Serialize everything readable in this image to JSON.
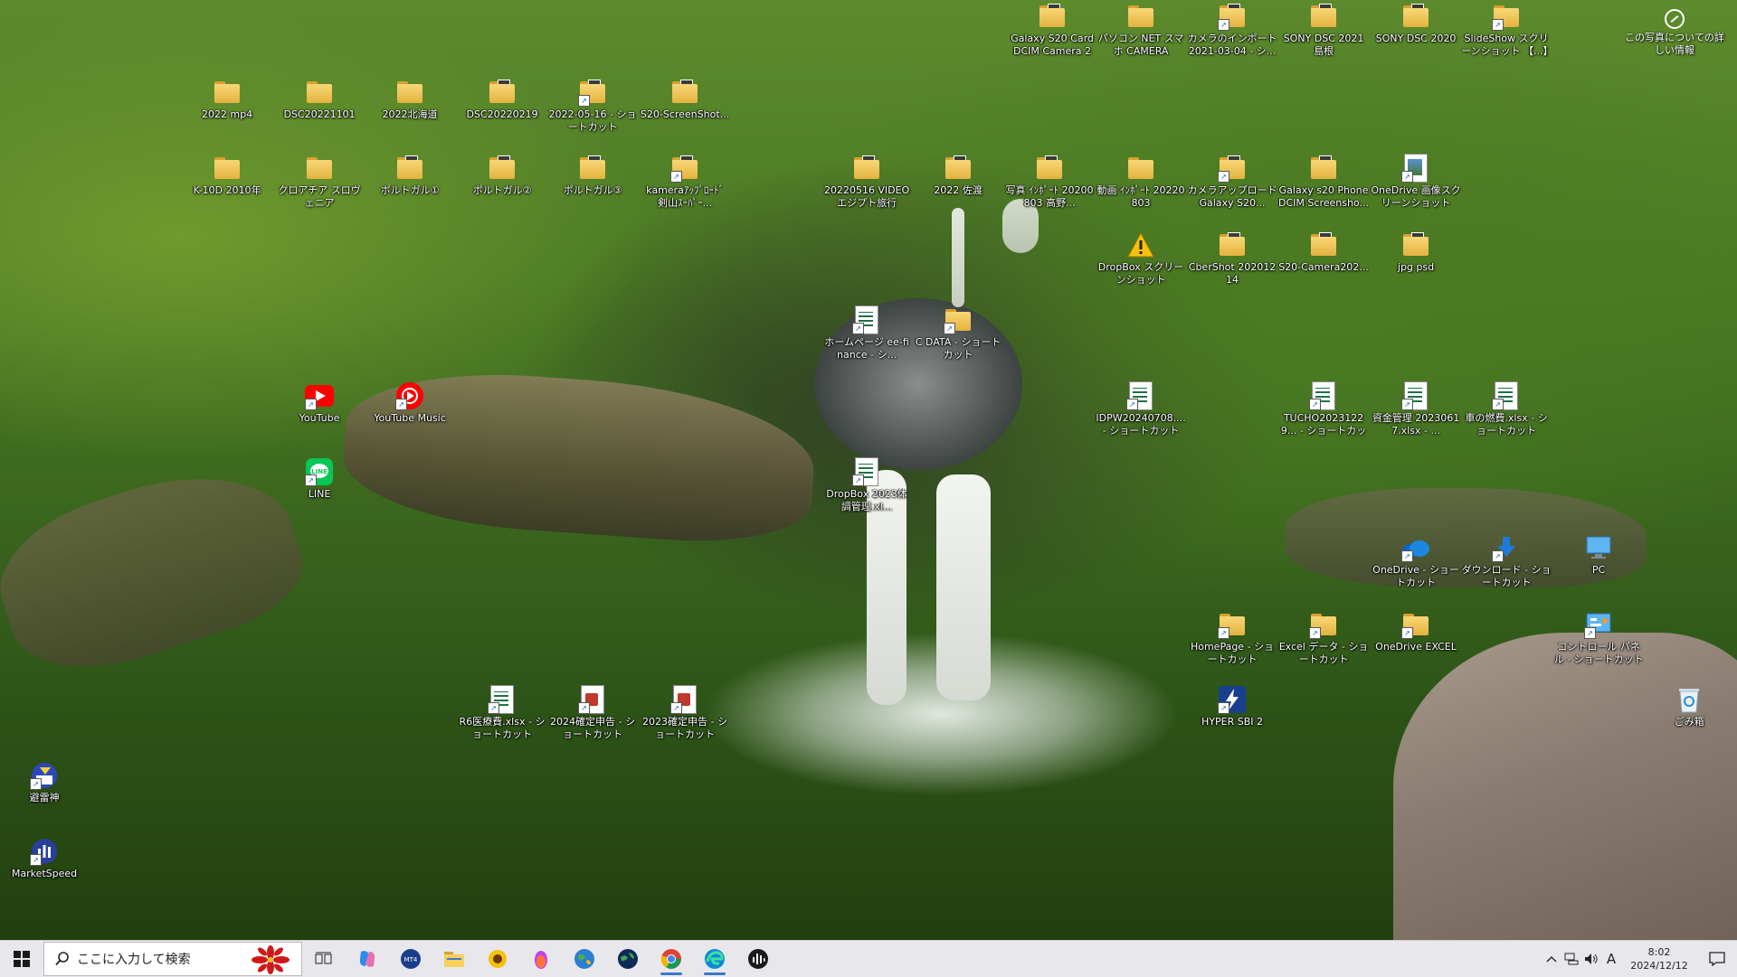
{
  "wallpaper": {
    "description_name": "waterfall-canyon"
  },
  "photo_info": {
    "label": "この写真についての詳しい情報"
  },
  "desktop_icons": [
    {
      "id": "g20card",
      "label": "Galaxy S20 Card DCIM Camera 20...",
      "type": "folder",
      "thumb": true,
      "shortcut": false
    },
    {
      "id": "pcnet",
      "label": "パソコン NET スマホ CAMERA",
      "type": "folder",
      "thumb": false,
      "shortcut": false
    },
    {
      "id": "camimport",
      "label": "カメラのインポート 2021-03-04 - シ...",
      "type": "folder",
      "thumb": true,
      "shortcut": true
    },
    {
      "id": "sony2021",
      "label": "SONY DSC 2021 島根",
      "type": "folder",
      "thumb": true,
      "shortcut": false
    },
    {
      "id": "sony2020",
      "label": "SONY DSC 2020",
      "type": "folder",
      "thumb": true,
      "shortcut": false
    },
    {
      "id": "slideshow",
      "label": "SlideShow スクリーンショット 【...】",
      "type": "folder",
      "thumb": false,
      "shortcut": true
    },
    {
      "id": "mp4",
      "label": "2022 mp4",
      "type": "folder",
      "thumb": false,
      "shortcut": false
    },
    {
      "id": "dsc20221101",
      "label": "DSC20221101",
      "type": "folder",
      "thumb": false,
      "shortcut": false
    },
    {
      "id": "hokkaido",
      "label": "2022北海道",
      "type": "folder",
      "thumb": false,
      "shortcut": false
    },
    {
      "id": "dsc20220219",
      "label": "DSC20220219",
      "type": "folder",
      "thumb": true,
      "shortcut": false
    },
    {
      "id": "s20240516",
      "label": "2022-05-16 - ショートカット",
      "type": "folder",
      "thumb": true,
      "shortcut": true
    },
    {
      "id": "s20ss",
      "label": "S20-ScreenShot...",
      "type": "folder",
      "thumb": true,
      "shortcut": false
    },
    {
      "id": "k10d",
      "label": "K-10D 2010年",
      "type": "folder",
      "thumb": false,
      "shortcut": false
    },
    {
      "id": "croatia",
      "label": "クロアチア スロヴェニア",
      "type": "folder",
      "thumb": false,
      "shortcut": false
    },
    {
      "id": "port1",
      "label": "ポルトガル①",
      "type": "folder",
      "thumb": true,
      "shortcut": false
    },
    {
      "id": "port2",
      "label": "ポルトガル②",
      "type": "folder",
      "thumb": true,
      "shortcut": false
    },
    {
      "id": "port3",
      "label": "ポルトガル③",
      "type": "folder",
      "thumb": true,
      "shortcut": false
    },
    {
      "id": "kamera",
      "label": "kameraｱｯﾌﾟﾛｰﾄﾞ 剣山ｽｰﾊﾟｰ...",
      "type": "folder",
      "thumb": true,
      "shortcut": true
    },
    {
      "id": "video0516",
      "label": "20220516 VIDEO エジプト旅行",
      "type": "folder",
      "thumb": true,
      "shortcut": false
    },
    {
      "id": "sado",
      "label": "2022 佐渡",
      "type": "folder",
      "thumb": true,
      "shortcut": false
    },
    {
      "id": "photo0803",
      "label": "写真 ｲﾝﾎﾟｰﾄ 20200803 高野...",
      "type": "folder",
      "thumb": true,
      "shortcut": false
    },
    {
      "id": "movie0803",
      "label": "動画 ｲﾝﾎﾟｰﾄ 20220803",
      "type": "folder",
      "thumb": false,
      "shortcut": false
    },
    {
      "id": "camupload",
      "label": "カメラアップロード Galaxy S20...",
      "type": "folder",
      "thumb": true,
      "shortcut": true
    },
    {
      "id": "gs20dcim",
      "label": "Galaxy s20 Phone DCIM Screensho...",
      "type": "folder",
      "thumb": true,
      "shortcut": false
    },
    {
      "id": "odimg",
      "label": "OneDrive 画像スクリーンショット",
      "type": "file-img",
      "thumb": false,
      "shortcut": true
    },
    {
      "id": "dbss",
      "label": "DropBox スクリーンショット",
      "type": "warning",
      "thumb": false,
      "shortcut": false
    },
    {
      "id": "cbershot",
      "label": "CberShot 20201214",
      "type": "folder",
      "thumb": true,
      "shortcut": false
    },
    {
      "id": "s20cam",
      "label": "S20-Camera202...",
      "type": "folder",
      "thumb": true,
      "shortcut": false
    },
    {
      "id": "jpgpsd",
      "label": "jpg psd",
      "type": "folder",
      "thumb": true,
      "shortcut": false
    },
    {
      "id": "homefin",
      "label": "ホームページ ee-finance - シ...",
      "type": "file-xls",
      "thumb": false,
      "shortcut": true
    },
    {
      "id": "cdata",
      "label": "C DATA - ショートカット",
      "type": "folder",
      "thumb": false,
      "shortcut": true
    },
    {
      "id": "youtube",
      "label": "YouTube",
      "type": "youtube",
      "thumb": false,
      "shortcut": true
    },
    {
      "id": "ytmusic",
      "label": "YouTube Music",
      "type": "ytmusic",
      "thumb": false,
      "shortcut": true
    },
    {
      "id": "line",
      "label": "LINE",
      "type": "line",
      "thumb": false,
      "shortcut": true
    },
    {
      "id": "idpw",
      "label": "IDPW20240708.... - ショートカット",
      "type": "file-xls",
      "thumb": false,
      "shortcut": true
    },
    {
      "id": "tucho",
      "label": "TUCHO20231229... - ショートカット",
      "type": "file-xls",
      "thumb": false,
      "shortcut": true
    },
    {
      "id": "shikin",
      "label": "資金管理 20230617.xlsx - ...",
      "type": "file-xls",
      "thumb": false,
      "shortcut": true
    },
    {
      "id": "nenpi",
      "label": "車の燃費.xlsx - ショートカット",
      "type": "file-xls",
      "thumb": false,
      "shortcut": true
    },
    {
      "id": "dbtaicho",
      "label": "DropBox 2023体調管理.xl...",
      "type": "file-xls",
      "thumb": false,
      "shortcut": true
    },
    {
      "id": "odshort",
      "label": "OneDrive - ショートカット",
      "type": "cloud",
      "thumb": false,
      "shortcut": true
    },
    {
      "id": "download",
      "label": "ダウンロード - ショートカット",
      "type": "download",
      "thumb": false,
      "shortcut": true
    },
    {
      "id": "pc",
      "label": "PC",
      "type": "pc",
      "thumb": false,
      "shortcut": false
    },
    {
      "id": "homepage",
      "label": "HomePage - ショートカット",
      "type": "folder",
      "thumb": false,
      "shortcut": true
    },
    {
      "id": "exceldata",
      "label": "Excel データ - ショートカット",
      "type": "folder",
      "thumb": false,
      "shortcut": true
    },
    {
      "id": "odexcel",
      "label": "OneDrive EXCEL",
      "type": "folder",
      "thumb": false,
      "shortcut": true
    },
    {
      "id": "control",
      "label": "コントロール パネル - ショートカット",
      "type": "control",
      "thumb": false,
      "shortcut": true
    },
    {
      "id": "hypersbi",
      "label": "HYPER SBI 2",
      "type": "hyper",
      "thumb": false,
      "shortcut": true
    },
    {
      "id": "recycle",
      "label": "ごみ箱",
      "type": "recycle",
      "thumb": false,
      "shortcut": false
    },
    {
      "id": "r6iryo",
      "label": "R6医療費.xlsx - ショートカット",
      "type": "file-xls",
      "thumb": false,
      "shortcut": true
    },
    {
      "id": "kakutei2024",
      "label": "2024確定申告 - ショートカット",
      "type": "file-pdf",
      "thumb": false,
      "shortcut": true
    },
    {
      "id": "kakutei2023",
      "label": "2023確定申告 - ショートカット",
      "type": "file-pdf",
      "thumb": false,
      "shortcut": true
    },
    {
      "id": "hirai",
      "label": "避雷神",
      "type": "hirai",
      "thumb": false,
      "shortcut": true
    },
    {
      "id": "marketspeed",
      "label": "MarketSpeed",
      "type": "marketspeed",
      "thumb": false,
      "shortcut": true
    }
  ],
  "taskbar": {
    "search_placeholder": "ここに入力して検索",
    "apps": [
      {
        "id": "taskview",
        "name": "task-view-icon"
      },
      {
        "id": "copilot",
        "name": "copilot-icon"
      },
      {
        "id": "mt4",
        "name": "mt4-icon"
      },
      {
        "id": "explorer",
        "name": "file-explorer-icon"
      },
      {
        "id": "sunflower",
        "name": "sunflower-app-icon"
      },
      {
        "id": "firefox",
        "name": "firefox-icon"
      },
      {
        "id": "globe1",
        "name": "globe-app-icon"
      },
      {
        "id": "globe2",
        "name": "earth-app-icon"
      },
      {
        "id": "chrome",
        "name": "chrome-icon",
        "active": true
      },
      {
        "id": "edge",
        "name": "edge-icon",
        "active": true
      },
      {
        "id": "audio",
        "name": "audio-app-icon"
      }
    ],
    "tray": {
      "ime": "A",
      "time": "8:02",
      "date": "2024/12/12"
    }
  }
}
